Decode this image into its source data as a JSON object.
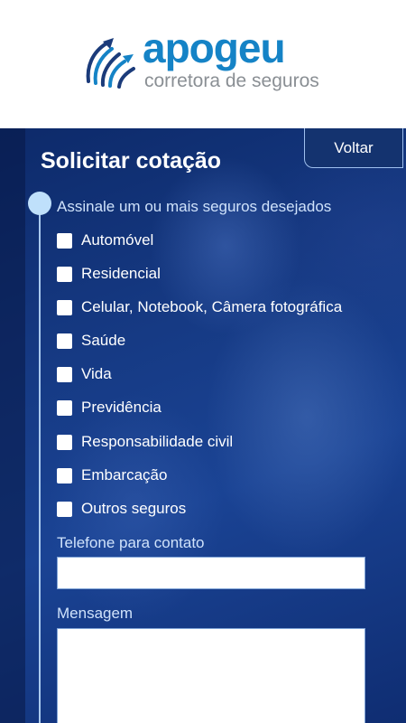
{
  "logo": {
    "name": "apogeu",
    "tagline": "corretora de seguros",
    "colors": {
      "primary": "#1583c6",
      "tagline": "#8a8f94"
    }
  },
  "form": {
    "title": "Solicitar cotação",
    "back_label": "Voltar",
    "section_label": "Assinale um ou mais seguros desejados",
    "options": [
      "Automóvel",
      "Residencial",
      "Celular, Notebook, Câmera fotográfica",
      "Saúde",
      "Vida",
      "Previdência",
      "Responsabilidade civil",
      "Embarcação",
      "Outros seguros"
    ],
    "phone_label": "Telefone para contato",
    "phone_value": "",
    "message_label": "Mensagem",
    "message_value": ""
  },
  "colors": {
    "panel": "#163a84",
    "accent_dot": "#bfe0fb"
  }
}
